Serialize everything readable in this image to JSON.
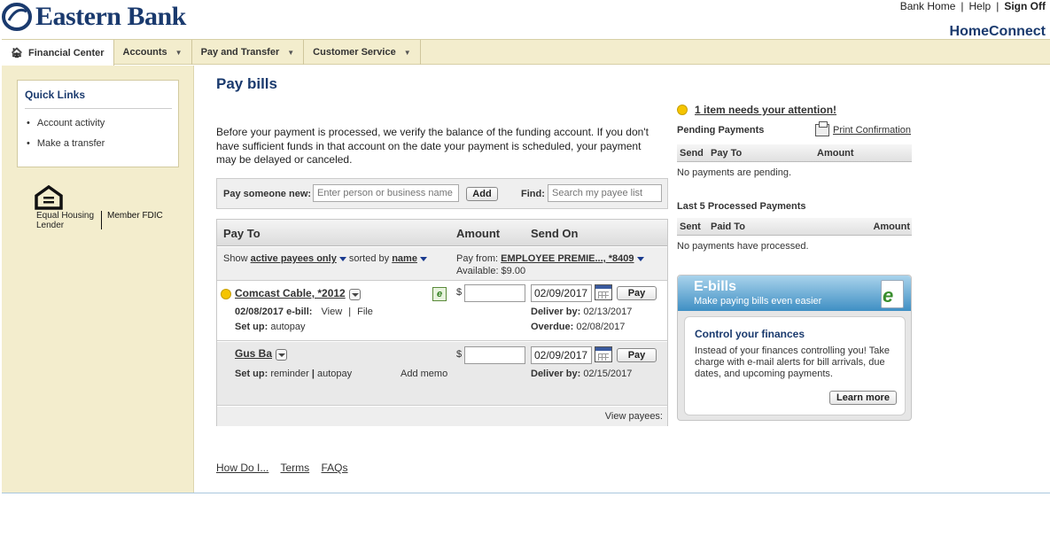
{
  "brand": {
    "name": "Eastern Bank",
    "color": "#1a3a6e"
  },
  "toplinks": {
    "bank_home": "Bank Home",
    "help": "Help",
    "sign_off": "Sign Off",
    "sep": "|"
  },
  "homeconnect": "HomeConnect",
  "nav": [
    {
      "label": "Financial Center"
    },
    {
      "label": "Accounts"
    },
    {
      "label": "Pay and Transfer"
    },
    {
      "label": "Customer Service"
    }
  ],
  "quick_links": {
    "title": "Quick Links",
    "items": [
      "Account activity",
      "Make a transfer"
    ]
  },
  "ehl": {
    "line1": "Equal Housing",
    "line2": "Lender",
    "fdic": "Member FDIC"
  },
  "page": {
    "title": "Pay bills",
    "intro": "Before your payment is processed, we verify the balance of the funding account. If you don't have sufficient funds in that account on the date your payment is scheduled, your payment may be delayed or canceled."
  },
  "pay_new": {
    "label": "Pay someone new:",
    "placeholder": "Enter person or business name",
    "add": "Add",
    "find_label": "Find:",
    "find_placeholder": "Search my payee list"
  },
  "table": {
    "headers": {
      "pay_to": "Pay To",
      "amount": "Amount",
      "send_on": "Send On"
    },
    "show": "Show",
    "filter": "active payees only",
    "sorted": "sorted by",
    "sort": "name",
    "pay_from_label": "Pay from:",
    "pay_from": "EMPLOYEE PREMIE..., *8409",
    "available": "Available: $9.00",
    "dollar": "$",
    "pay": "Pay",
    "rows": [
      {
        "payee": "Comcast Cable, *2012",
        "ebill_date": "02/08/2017 e-bill:",
        "view": "View",
        "sep": "|",
        "file": "File",
        "setup_label": "Set up:",
        "setup": "autopay",
        "date": "02/09/2017",
        "deliver_label": "Deliver by:",
        "deliver": "02/13/2017",
        "overdue_label": "Overdue:",
        "overdue": "02/08/2017"
      },
      {
        "payee": "Gus Ba",
        "setup_label": "Set up:",
        "setup_reminder": "reminder",
        "sep": "|",
        "setup_autopay": "autopay",
        "memo": "Add memo",
        "date": "02/09/2017",
        "deliver_label": "Deliver by:",
        "deliver": "02/15/2017"
      }
    ],
    "view_payees": "View payees:"
  },
  "footer_links": [
    "How Do I...",
    "Terms",
    "FAQs"
  ],
  "right": {
    "attention": "1 item needs your attention!",
    "pending_title": "Pending Payments",
    "print_confirmation": "Print Confirmation",
    "pending_headers": [
      "Send",
      "Pay To",
      "Amount"
    ],
    "pending_empty": "No payments are pending.",
    "processed_title": "Last 5 Processed Payments",
    "processed_headers": [
      "Sent",
      "Paid To",
      "Amount"
    ],
    "processed_empty": "No payments have processed."
  },
  "ebills": {
    "title": "E-bills",
    "subtitle": "Make paying bills even easier",
    "heading": "Control your finances",
    "body": "Instead of your finances controlling you! Take charge with e-mail alerts for bill arrivals, due dates, and upcoming payments.",
    "button": "Learn more"
  }
}
